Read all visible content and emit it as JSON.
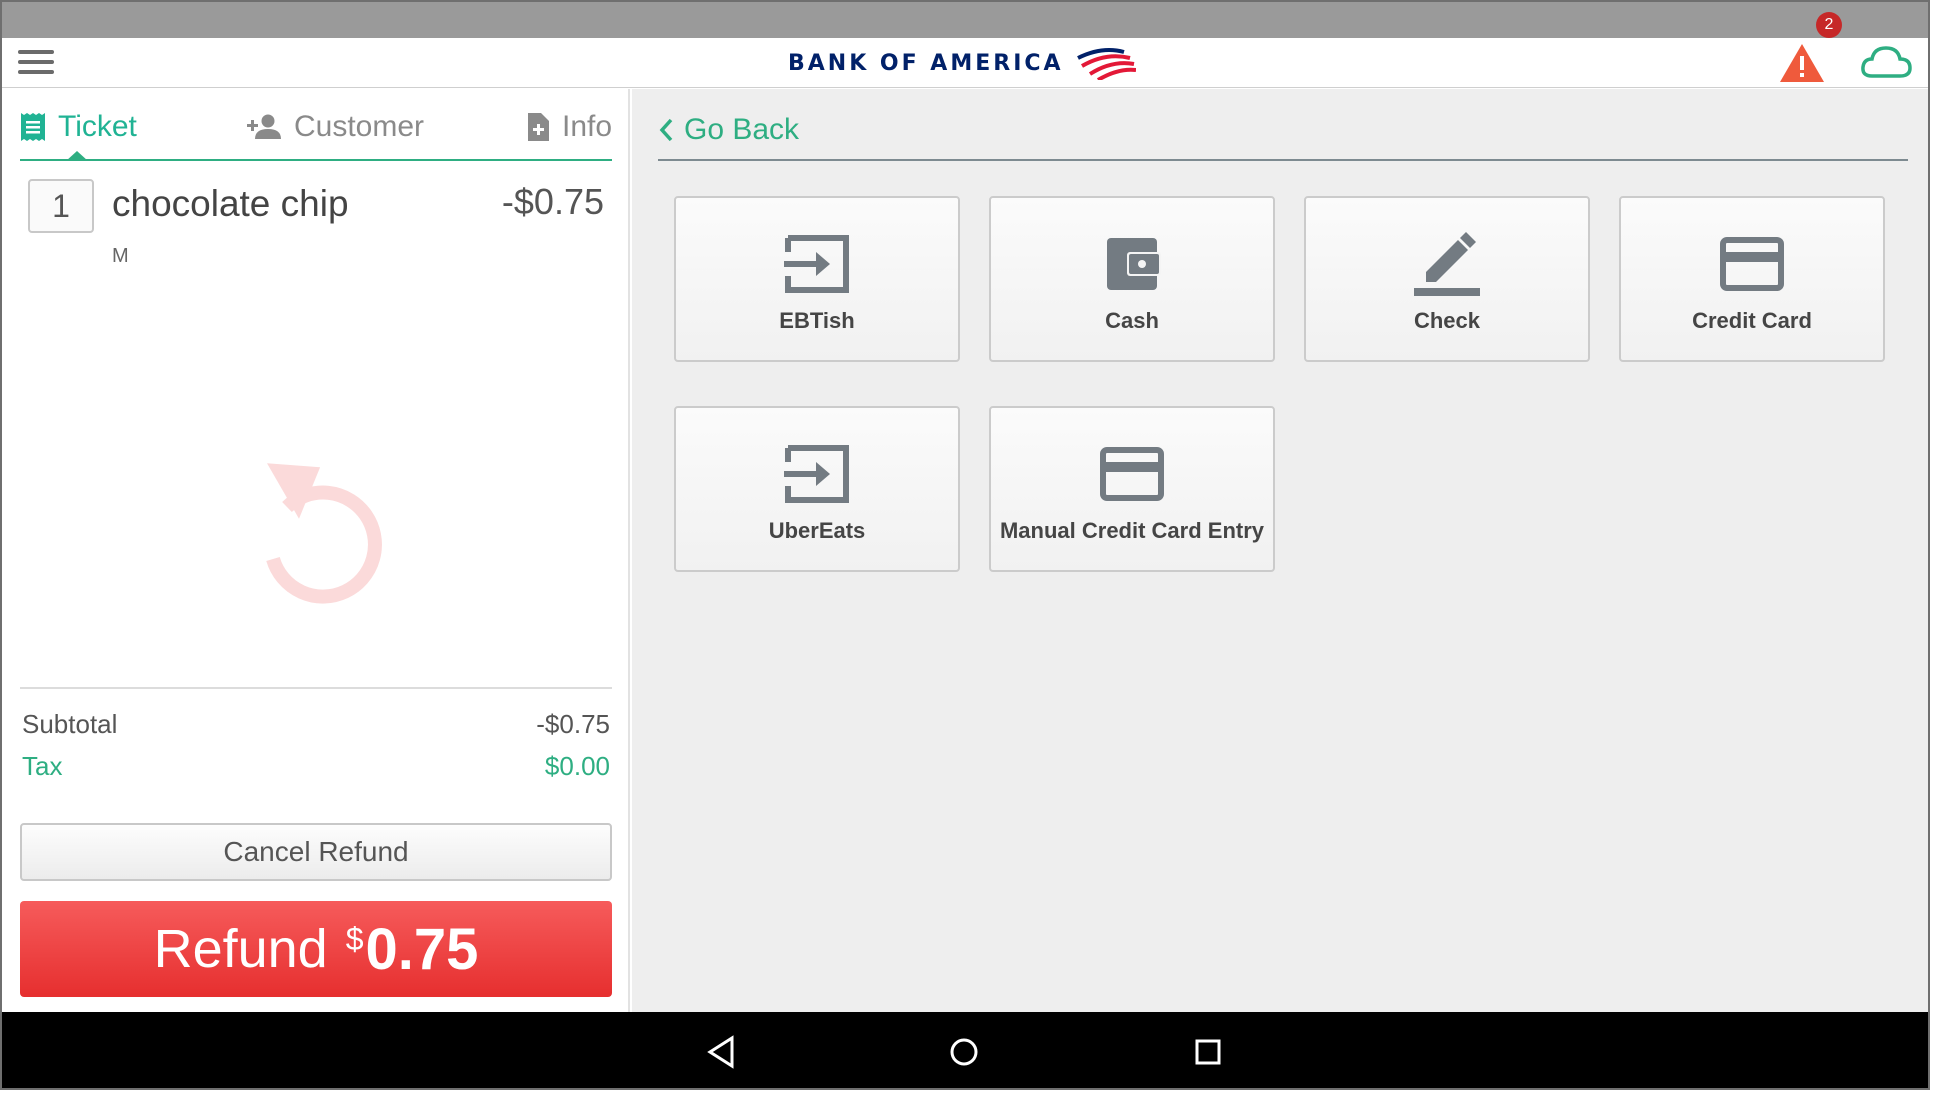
{
  "app": {
    "brand": "BANK OF AMERICA",
    "alert_count": "2",
    "colors": {
      "accent": "#2eae82",
      "refund": "#ee3b3b",
      "brand_blue": "#012169",
      "brand_red": "#e31837"
    }
  },
  "tabs": [
    {
      "label": "Ticket",
      "icon": "receipt-icon",
      "active": true
    },
    {
      "label": "Customer",
      "icon": "add-person-icon",
      "active": false
    },
    {
      "label": "Info",
      "icon": "add-document-icon",
      "active": false
    }
  ],
  "ticket": {
    "items": [
      {
        "qty": "1",
        "name": "chocolate chip",
        "price": "-$0.75",
        "modifier": "M"
      }
    ]
  },
  "totals": {
    "subtotal_label": "Subtotal",
    "subtotal_value": "-$0.75",
    "tax_label": "Tax",
    "tax_value": "$0.00"
  },
  "actions": {
    "cancel_label": "Cancel Refund",
    "refund_label": "Refund",
    "refund_currency": "$",
    "refund_amount": "0.75"
  },
  "payment": {
    "go_back_label": "Go Back",
    "methods": [
      {
        "label": "EBTish",
        "icon": "input-arrow-icon"
      },
      {
        "label": "Cash",
        "icon": "wallet-icon"
      },
      {
        "label": "Check",
        "icon": "pencil-icon"
      },
      {
        "label": "Credit Card",
        "icon": "credit-card-icon"
      },
      {
        "label": "UberEats",
        "icon": "input-arrow-icon"
      },
      {
        "label": "Manual Credit Card Entry",
        "icon": "credit-card-icon"
      }
    ]
  }
}
